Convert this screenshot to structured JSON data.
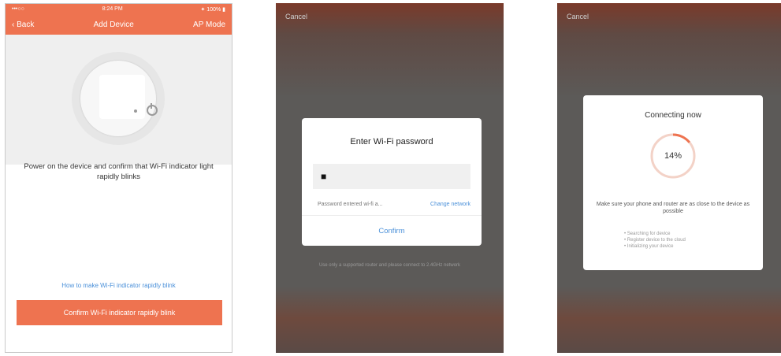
{
  "screen1": {
    "status": {
      "left": "•••○○",
      "center": "8:24 PM",
      "right": "✦ 100% ▮"
    },
    "nav": {
      "back": "‹ Back",
      "title": "Add Device",
      "right": "AP Mode"
    },
    "instruction": "Power on the device and confirm that Wi-Fi indicator light rapidly blinks",
    "help_link": "How to make Wi-Fi indicator rapidly blink",
    "confirm_button": "Confirm Wi-Fi indicator rapidly blink"
  },
  "screen2": {
    "cancel": "Cancel",
    "dialog_title": "Enter Wi-Fi password",
    "password_value": "■",
    "hint": "Password entered  wi-fi a...",
    "change_network": "Change network",
    "confirm": "Confirm",
    "footer": "Use only a supported router and please connect to 2.4GHz network"
  },
  "screen3": {
    "cancel": "Cancel",
    "title": "Connecting now",
    "percent": "14%",
    "progress": 0.14,
    "note": "Make sure your phone and router are as close to the device as possible",
    "steps": [
      "Searching for device",
      "Register device to the cloud",
      "Initializing your device"
    ]
  },
  "colors": {
    "accent": "#ee7350",
    "link": "#4a90d9"
  }
}
